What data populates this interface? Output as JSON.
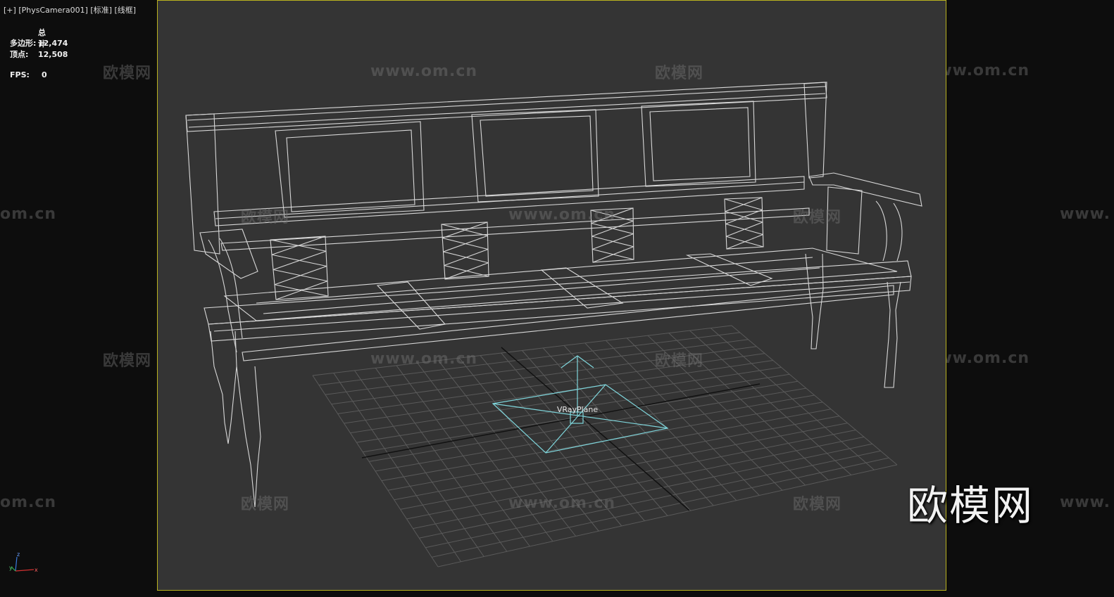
{
  "viewport": {
    "label_plus": "[+]",
    "label_camera": "[PhysCamera001]",
    "label_shading": "[标准]",
    "label_mode": "[线框]",
    "border_color": "#b9b21e",
    "background": "#343434"
  },
  "stats": {
    "header": "总计",
    "polygons_label": "多边形:",
    "polygons_value": "12,474",
    "vertices_label": "顶点:",
    "vertices_value": "12,508",
    "fps_label": "FPS:",
    "fps_value": "0"
  },
  "scene": {
    "object_label": "VRayPlane",
    "wireframe_color": "#d8d8d8",
    "helper_color": "#7fd6dc"
  },
  "watermark": {
    "brand": "欧模网",
    "url": "www.om.cn",
    "url_partial": "om.cn",
    "url_edge": "www.",
    "logo": "欧模网"
  },
  "axis_gizmo": {
    "z": "z",
    "x": "x",
    "y": "y"
  }
}
